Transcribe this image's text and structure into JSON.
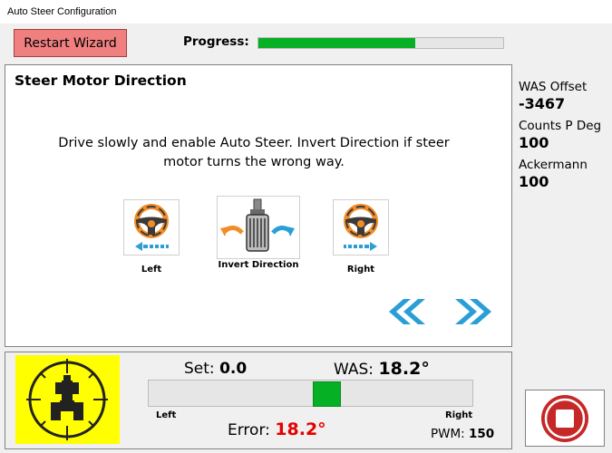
{
  "window": {
    "title": "Auto Steer Configuration"
  },
  "toolbar": {
    "restart_label": "Restart Wizard"
  },
  "progress": {
    "label": "Progress:",
    "fraction": 0.64
  },
  "panel": {
    "title": "Steer Motor Direction",
    "instructions_line1": "Drive slowly and enable Auto Steer. Invert Direction if steer",
    "instructions_line2": "motor turns the wrong way."
  },
  "buttons": {
    "left_label": "Left",
    "invert_label": "Invert Direction",
    "right_label": "Right"
  },
  "icons": {
    "previous": "double-chevron-left-icon",
    "next": "double-chevron-right-icon",
    "stop": "stop-icon"
  },
  "info": {
    "was_offset_label": "WAS Offset",
    "was_offset_value": "-3467",
    "counts_label": "Counts P Deg",
    "counts_value": "100",
    "ackermann_label": "Ackermann",
    "ackermann_value": "100"
  },
  "status": {
    "set_label": "Set:",
    "set_value": "0.0",
    "was_label": "WAS:",
    "was_value": "18.2°",
    "slider_left": "Left",
    "slider_right": "Right",
    "slider_fraction": 0.55,
    "error_label": "Error:",
    "error_value": "18.2°",
    "pwm_label": "PWM:",
    "pwm_value": "150"
  },
  "colors": {
    "progress": "#06b025",
    "restart": "#f08080",
    "error": "#e60000",
    "arrow": "#2a9fd6",
    "wheel": "#f28c28",
    "tractor_bg": "#ffff00",
    "stop": "#c62828"
  }
}
